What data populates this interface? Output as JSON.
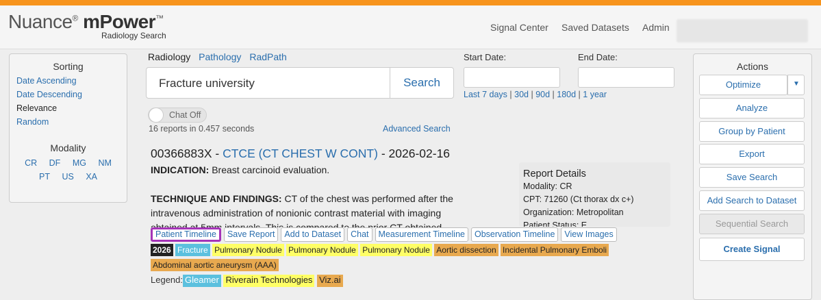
{
  "brand": {
    "name_a": "Nuance",
    "name_b": "mPower",
    "subtitle": "Radiology Search"
  },
  "nav": {
    "signal_center": "Signal Center",
    "saved_datasets": "Saved Datasets",
    "admin": "Admin"
  },
  "sorting": {
    "title": "Sorting",
    "items": [
      "Date Ascending",
      "Date Descending",
      "Relevance",
      "Random"
    ]
  },
  "modality": {
    "title": "Modality",
    "row1": [
      "CR",
      "DF",
      "MG",
      "NM"
    ],
    "row2": [
      "PT",
      "US",
      "XA"
    ]
  },
  "tabs": [
    "Radiology",
    "Pathology",
    "RadPath"
  ],
  "search": {
    "query": "Fracture university",
    "button": "Search"
  },
  "dates": {
    "start_label": "Start Date:",
    "end_label": "End Date:",
    "quick": [
      "Last 7 days",
      "30d",
      "90d",
      "180d",
      "1 year"
    ]
  },
  "chat_toggle": "Chat Off",
  "stats": "16 reports in 0.457 seconds",
  "advanced_search": "Advanced Search",
  "result": {
    "accession": "00366883X",
    "exam": "CTCE (CT CHEST W CONT)",
    "date": "2026-02-16",
    "indication_label": "INDICATION:",
    "indication": "Breast carcinoid evaluation.",
    "findings_label": "TECHNIQUE AND FINDINGS:",
    "findings": "CT of the chest was performed after the intravenous administration of nonionic contrast material with imaging obtained at 5mm intervals. This is compared to the prior CT obtained"
  },
  "details": {
    "title": "Report Details",
    "modality": "Modality: CR",
    "cpt": "CPT: 71260 (Ct thorax dx c+)",
    "org": "Organization: Metropolitan",
    "patient_status": "Patient Status: E"
  },
  "result_actions": [
    "Patient Timeline",
    "Save Report",
    "Add to Dataset",
    "Chat",
    "Measurement Timeline",
    "Observation Timeline",
    "View Images"
  ],
  "tags": {
    "year": "2026",
    "fracture": "Fracture",
    "nodule1": "Pulmonary Nodule",
    "nodule2": "Pulmonary Nodule",
    "nodule3": "Pulmonary Nodule",
    "aortic": "Aortic dissection",
    "emboli": "Incidental Pulmonary Emboli",
    "aaa": "Abdominal aortic aneurysm (AAA)"
  },
  "legend": {
    "label": "Legend:",
    "gleamer": "Gleamer",
    "riverain": "Riverain Technologies",
    "vizai": "Viz.ai"
  },
  "actions": {
    "title": "Actions",
    "optimize": "Optimize",
    "analyze": "Analyze",
    "group": "Group by Patient",
    "export": "Export",
    "save_search": "Save Search",
    "add_search": "Add Search to Dataset",
    "sequential": "Sequential Search",
    "create_signal": "Create Signal"
  },
  "colors": {
    "accent": "#f7941d",
    "link": "#2a6ead",
    "highlight": "#a534b8",
    "tag_yellow": "#ffff66",
    "tag_orange": "#e8a94f",
    "tag_blue": "#5bc0de"
  }
}
